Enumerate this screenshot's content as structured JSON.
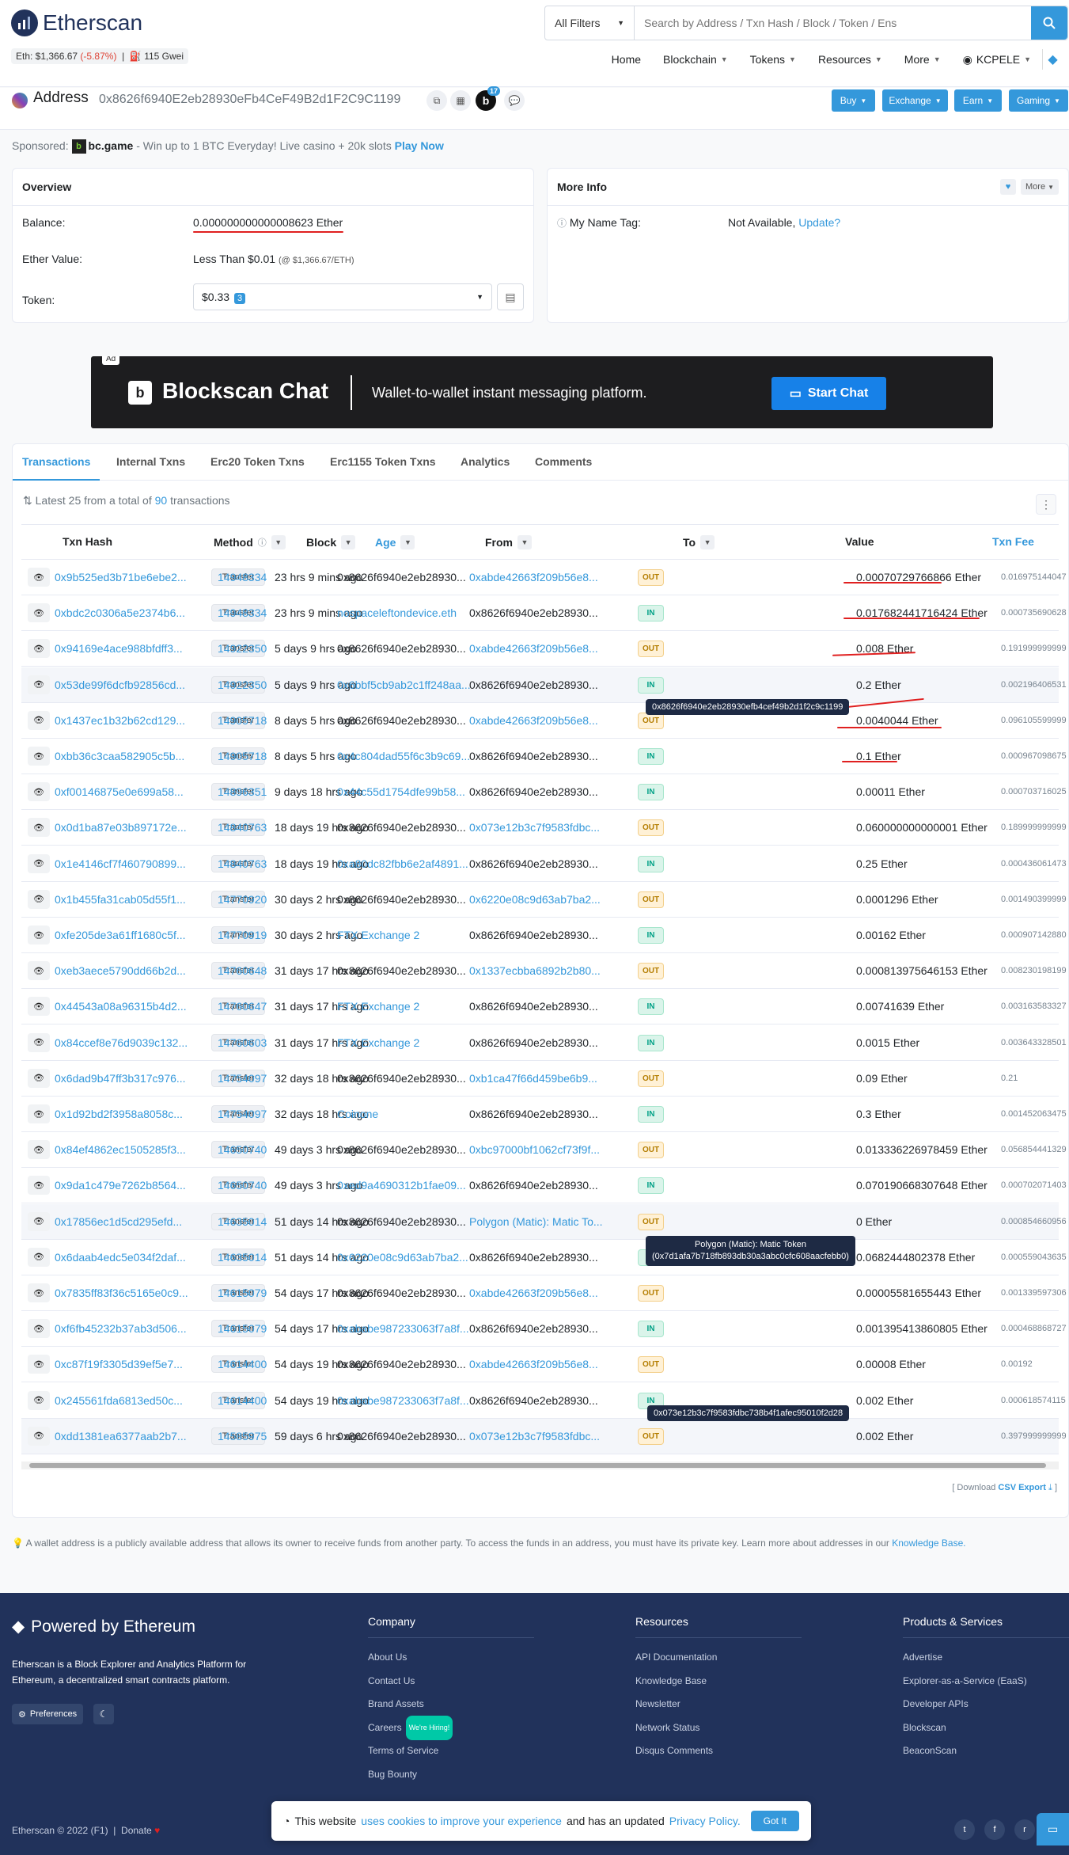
{
  "header": {
    "brand": "Etherscan",
    "eth_price_label": "Eth: $1,366.67",
    "eth_change": "(-5.87%)",
    "gas": "115 Gwei",
    "search_filter": "All Filters",
    "search_placeholder": "Search by Address / Txn Hash / Block / Token / Ens",
    "nav": [
      "Home",
      "Blockchain",
      "Tokens",
      "Resources",
      "More",
      "KCPELE"
    ]
  },
  "address": {
    "label": "Address",
    "hash": "0x8626f6940E2eb28930eFb4CeF49B2d1F2C9C1199",
    "badge_letter": "b",
    "badge_count": "17",
    "buttons": [
      "Buy",
      "Exchange",
      "Earn",
      "Gaming"
    ]
  },
  "sponsor": {
    "prefix": "Sponsored:",
    "name": "bc.game",
    "text": "- Win up to 1 BTC Everyday! Live casino + 20k slots",
    "cta": "Play Now"
  },
  "overview": {
    "title": "Overview",
    "balance_label": "Balance:",
    "balance_value": "0.000000000000008623 Ether",
    "ether_value_label": "Ether Value:",
    "ether_value": "Less Than $0.01",
    "ether_value_rate": "(@ $1,366.67/ETH)",
    "token_label": "Token:",
    "token_value": "$0.33",
    "token_count": "3"
  },
  "moreinfo": {
    "title": "More Info",
    "more_btn": "More",
    "name_tag_label": "My Name Tag:",
    "name_tag_value": "Not Available,",
    "name_tag_link": "Update?"
  },
  "banner": {
    "ad": "Ad",
    "title": "Blockscan Chat",
    "subtitle": "Wallet-to-wallet instant messaging platform.",
    "button": "Start Chat"
  },
  "tabs": [
    "Transactions",
    "Internal Txns",
    "Erc20 Token Txns",
    "Erc1155 Token Txns",
    "Analytics",
    "Comments"
  ],
  "txinfo": {
    "prefix": "Latest 25 from a total of",
    "count": "90",
    "suffix": "transactions"
  },
  "columns": [
    "Txn Hash",
    "Method",
    "Block",
    "Age",
    "From",
    "To",
    "Value",
    "Txn Fee"
  ],
  "transactions": [
    {
      "hash": "0x9b525ed3b71be6ebe2...",
      "method": "Transfer",
      "block": "14948334",
      "age": "23 hrs 9 mins ago",
      "from": "0x8626f6940e2eb28930...",
      "dir": "OUT",
      "to": "0xabde42663f209b56e8...",
      "value": "0.00070729766866 Ether",
      "fee": "0.016975144047"
    },
    {
      "hash": "0xbdc2c0306a5e2374b6...",
      "method": "Transfer",
      "block": "14948334",
      "age": "23 hrs 9 mins ago",
      "from": "nospaceleftondevice.eth",
      "dir": "IN",
      "to": "0x8626f6940e2eb28930...",
      "value": "0.017682441716424 Ether",
      "fee": "0.000735690628"
    },
    {
      "hash": "0x94169e4ace988bfdff3...",
      "method": "Transfer",
      "block": "14922350",
      "age": "5 days 9 hrs ago",
      "from": "0x8626f6940e2eb28930...",
      "dir": "OUT",
      "to": "0xabde42663f209b56e8...",
      "value": "0.008 Ether",
      "fee": "0.191999999999"
    },
    {
      "hash": "0x53de99f6dcfb92856cd...",
      "method": "Transfer",
      "block": "14922350",
      "age": "5 days 9 hrs ago",
      "from": "0x6bbf5cb9ab2c1ff248aa...",
      "dir": "IN",
      "to": "0x8626f6940e2eb28930...",
      "value": "0.2 Ether",
      "fee": "0.002196406531"
    },
    {
      "hash": "0x1437ec1b32b62cd129...",
      "method": "Transfer",
      "block": "14905718",
      "age": "8 days 5 hrs ago",
      "from": "0x8626f6940e2eb28930...",
      "dir": "OUT",
      "to": "0xabde42663f209b56e8...",
      "value": "0.0040044 Ether",
      "fee": "0.096105599999"
    },
    {
      "hash": "0xbb36c3caa582905c5b...",
      "method": "Transfer",
      "block": "14905718",
      "age": "8 days 5 hrs ago",
      "from": "0x4c804dad55f6c3b9c69...",
      "dir": "IN",
      "to": "0x8626f6940e2eb28930...",
      "value": "0.1 Ether",
      "fee": "0.000967098675"
    },
    {
      "hash": "0xf00146875e0e699a58...",
      "method": "Transfer",
      "block": "14896351",
      "age": "9 days 18 hrs ago",
      "from": "0x44c55d1754dfe99b58...",
      "dir": "IN",
      "to": "0x8626f6940e2eb28930...",
      "value": "0.00011 Ether",
      "fee": "0.000703716025"
    },
    {
      "hash": "0x0d1ba87e03b897172e...",
      "method": "Transfer",
      "block": "14840763",
      "age": "18 days 19 hrs ago",
      "from": "0x8626f6940e2eb28930...",
      "dir": "OUT",
      "to": "0x073e12b3c7f9583fdbc...",
      "value": "0.060000000000001 Ether",
      "fee": "0.189999999999"
    },
    {
      "hash": "0x1e4146cf7f460790899...",
      "method": "Transfer",
      "block": "14840763",
      "age": "18 days 19 hrs ago",
      "from": "0xa80dc82fbb6e2af4891...",
      "dir": "IN",
      "to": "0x8626f6940e2eb28930...",
      "value": "0.25 Ether",
      "fee": "0.000436061473"
    },
    {
      "hash": "0x1b455fa31cab05d55f1...",
      "method": "Transfer",
      "block": "14770920",
      "age": "30 days 2 hrs ago",
      "from": "0x8626f6940e2eb28930...",
      "dir": "OUT",
      "to": "0x6220e08c9d63ab7ba2...",
      "value": "0.0001296 Ether",
      "fee": "0.001490399999"
    },
    {
      "hash": "0xfe205de3a61ff1680c5f...",
      "method": "Transfer",
      "block": "14770919",
      "age": "30 days 2 hrs ago",
      "from": "FTX Exchange 2",
      "dir": "IN",
      "to": "0x8626f6940e2eb28930...",
      "value": "0.00162 Ether",
      "fee": "0.000907142880"
    },
    {
      "hash": "0xeb3aece5790dd66b2d...",
      "method": "Transfer",
      "block": "14760648",
      "age": "31 days 17 hrs ago",
      "from": "0x8626f6940e2eb28930...",
      "dir": "OUT",
      "to": "0x1337ecbba6892b2b80...",
      "value": "0.000813975646153 Ether",
      "fee": "0.008230198199"
    },
    {
      "hash": "0x44543a08a96315b4d2...",
      "method": "Transfer",
      "block": "14760647",
      "age": "31 days 17 hrs ago",
      "from": "FTX Exchange 2",
      "dir": "IN",
      "to": "0x8626f6940e2eb28930...",
      "value": "0.00741639 Ether",
      "fee": "0.003163583327"
    },
    {
      "hash": "0x84ccef8e76d9039c132...",
      "method": "Transfer",
      "block": "14760603",
      "age": "31 days 17 hrs ago",
      "from": "FTX Exchange 2",
      "dir": "IN",
      "to": "0x8626f6940e2eb28930...",
      "value": "0.0015 Ether",
      "fee": "0.003643328501"
    },
    {
      "hash": "0x6dad9b47ff3b317c976...",
      "method": "Transfer",
      "block": "14754097",
      "age": "32 days 18 hrs ago",
      "from": "0x8626f6940e2eb28930...",
      "dir": "OUT",
      "to": "0xb1ca47f66d459be6b9...",
      "value": "0.09 Ether",
      "fee": "0.21"
    },
    {
      "hash": "0x1d92bd2f3958a8058c...",
      "method": "Transfer",
      "block": "14754097",
      "age": "32 days 18 hrs ago",
      "from": "Coinone",
      "dir": "IN",
      "to": "0x8626f6940e2eb28930...",
      "value": "0.3 Ether",
      "fee": "0.001452063475"
    },
    {
      "hash": "0x84ef4862ec1505285f3...",
      "method": "Transfer",
      "block": "14650740",
      "age": "49 days 3 hrs ago",
      "from": "0x8626f6940e2eb28930...",
      "dir": "OUT",
      "to": "0xbc97000bf1062cf73f9f...",
      "value": "0.013336226978459 Ether",
      "fee": "0.056854441329"
    },
    {
      "hash": "0x9da1c479e7262b8564...",
      "method": "Transfer",
      "block": "14650740",
      "age": "49 days 3 hrs ago",
      "from": "0xed9a4690312b1fae09...",
      "dir": "IN",
      "to": "0x8626f6940e2eb28930...",
      "value": "0.070190668307648 Ether",
      "fee": "0.000702071403"
    },
    {
      "hash": "0x17856ec1d5cd295efd...",
      "method": "Transfer",
      "block": "14635014",
      "age": "51 days 14 hrs ago",
      "from": "0x8626f6940e2eb28930...",
      "dir": "OUT",
      "to": "Polygon (Matic): Matic To...",
      "value": "0 Ether",
      "fee": "0.000854660956"
    },
    {
      "hash": "0x6daab4edc5e034f2daf...",
      "method": "Transfer",
      "block": "14635014",
      "age": "51 days 14 hrs ago",
      "from": "0x6220e08c9d63ab7ba2...",
      "dir": "IN",
      "to": "0x8626f6940e2eb28930...",
      "value": "0.0682444802378 Ether",
      "fee": "0.000559043635"
    },
    {
      "hash": "0x7835ff83f36c5165e0c9...",
      "method": "Transfer",
      "block": "14615079",
      "age": "54 days 17 hrs ago",
      "from": "0x8626f6940e2eb28930...",
      "dir": "OUT",
      "to": "0xabde42663f209b56e8...",
      "value": "0.00005581655443 Ether",
      "fee": "0.001339597306"
    },
    {
      "hash": "0xf6fb45232b37ab3d506...",
      "method": "Transfer",
      "block": "14615079",
      "age": "54 days 17 hrs ago",
      "from": "0xababe987233063f7a8f...",
      "dir": "IN",
      "to": "0x8626f6940e2eb28930...",
      "value": "0.001395413860805 Ether",
      "fee": "0.000468868727"
    },
    {
      "hash": "0xc87f19f3305d39ef5e7...",
      "method": "Transfer",
      "block": "14614400",
      "age": "54 days 19 hrs ago",
      "from": "0x8626f6940e2eb28930...",
      "dir": "OUT",
      "to": "0xabde42663f209b56e8...",
      "value": "0.00008 Ether",
      "fee": "0.00192"
    },
    {
      "hash": "0x245561fda6813ed50c...",
      "method": "Transfer",
      "block": "14614400",
      "age": "54 days 19 hrs ago",
      "from": "0xababe987233063f7a8f...",
      "dir": "IN",
      "to": "0x8626f6940e2eb28930...",
      "value": "0.002 Ether",
      "fee": "0.000618574115"
    },
    {
      "hash": "0xdd1381ea6377aab2b7...",
      "method": "Transfer",
      "block": "14585975",
      "age": "59 days 6 hrs ago",
      "from": "0x8626f6940e2eb28930...",
      "dir": "OUT",
      "to": "0x073e12b3c7f9583fdbc...",
      "value": "0.002 Ether",
      "fee": "0.397999999999"
    }
  ],
  "tooltips": {
    "t1": "0x8626f6940e2eb28930efb4cef49b2d1f2c9c1199",
    "t2_line1": "Polygon (Matic): Matic Token",
    "t2_line2": "(0x7d1afa7b718fb893db30a3abc0cfc608aacfebb0)",
    "t3": "0x073e12b3c7f9583fdbc738b4f1afec95010f2d28"
  },
  "csv": {
    "prefix": "[ Download",
    "link": "CSV Export",
    "suffix": "]"
  },
  "note": "A wallet address is a publicly available address that allows its owner to receive funds from another party. To access the funds in an address, you must have its private key. Learn more about addresses in our",
  "note_link": "Knowledge Base.",
  "footer": {
    "brand": "Powered by Ethereum",
    "desc": "Etherscan is a Block Explorer and Analytics Platform for Ethereum, a decentralized smart contracts platform.",
    "preferences": "Preferences",
    "company_title": "Company",
    "company": [
      "About Us",
      "Contact Us",
      "Brand Assets",
      "Careers",
      "Terms of Service",
      "Bug Bounty"
    ],
    "hiring": "We're Hiring!",
    "resources_title": "Resources",
    "resources": [
      "API Documentation",
      "Knowledge Base",
      "Newsletter",
      "Network Status",
      "Disqus Comments"
    ],
    "products_title": "Products & Services",
    "products": [
      "Advertise",
      "Explorer-as-a-Service (EaaS)",
      "Developer APIs",
      "Blockscan",
      "BeaconScan"
    ],
    "copyright": "Etherscan © 2022 (F1)",
    "donate": "Donate"
  },
  "cookie": {
    "pre": "This website",
    "link1": "uses cookies to improve your experience",
    "mid": "and has an updated",
    "link2": "Privacy Policy.",
    "btn": "Got It"
  }
}
